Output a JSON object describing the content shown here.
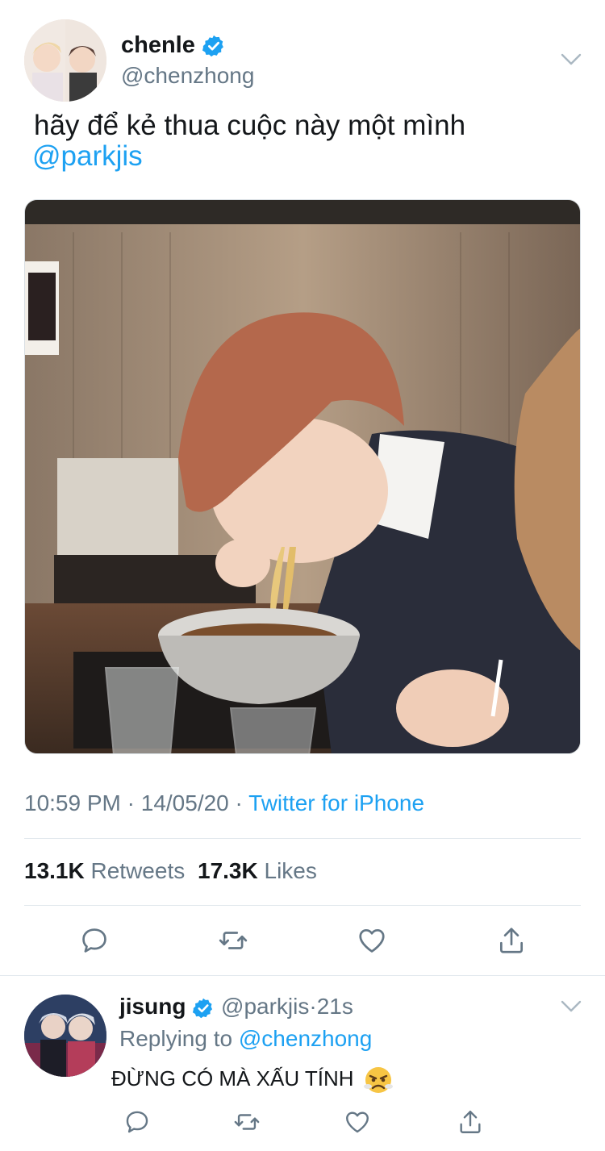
{
  "tweet": {
    "display_name": "chenle",
    "handle": "@chenzhong",
    "text": "hãy để kẻ thua cuộc này một mình",
    "mention": "@parkjis",
    "time": "10:59 PM",
    "date": "14/05/20",
    "source": "Twitter for iPhone",
    "retweets_count": "13.1K",
    "retweets_label": "Retweets",
    "likes_count": "17.3K",
    "likes_label": "Likes",
    "media_icon": "photo-of-person-eating-noodles"
  },
  "actions": [
    "reply-icon",
    "retweet-icon",
    "like-icon",
    "share-icon"
  ],
  "reply": {
    "display_name": "jisung",
    "handle": "@parkjis",
    "time": "21s",
    "replying_prefix": "Replying to",
    "replying_to": "@chenzhong",
    "text": "ĐỪNG CÓ MÀ XẤU TÍNH",
    "emoji_icon": "angry-face-icon"
  },
  "colors": {
    "link": "#1da1f2",
    "secondary_text": "#657786",
    "primary_text": "#14171a",
    "divider": "#e1e8ed"
  }
}
